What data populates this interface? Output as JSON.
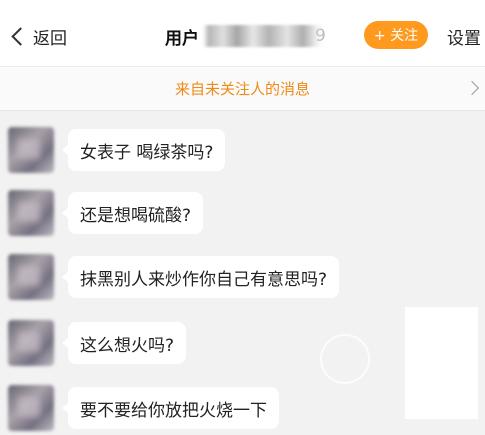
{
  "header": {
    "back_label": "返回",
    "user_prefix": "用户",
    "user_suffix": "9",
    "follow_label": "+ 关注",
    "settings_label": "设置"
  },
  "notice": {
    "text": "来自未关注人的消息"
  },
  "messages": [
    {
      "text": "女表子 喝绿茶吗?"
    },
    {
      "text": "还是想喝硫酸?"
    },
    {
      "text": "抹黑别人来炒作你自己有意思吗?"
    },
    {
      "text": "这么想火吗?"
    },
    {
      "text": "要不要给你放把火烧一下"
    }
  ],
  "colors": {
    "accent": "#ff9a1f",
    "notice_text": "#f08a17",
    "background": "#f2f2f2"
  }
}
